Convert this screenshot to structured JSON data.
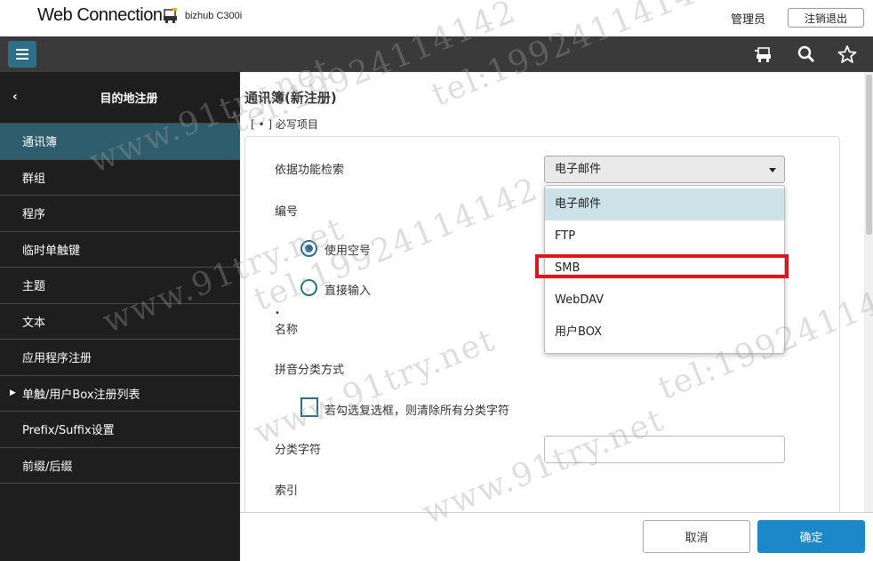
{
  "header": {
    "brand": "Web Connection",
    "device_name": "bizhub C300i",
    "user_label": "管理员",
    "logout_label": "注销退出"
  },
  "toolbar": {
    "icons": [
      "menu-icon",
      "printer-icon",
      "search-icon",
      "star-icon"
    ]
  },
  "sidebar": {
    "back_label": "‹",
    "title": "目的地注册",
    "items": [
      {
        "label": "通讯簿",
        "active": true
      },
      {
        "label": "群组"
      },
      {
        "label": "程序"
      },
      {
        "label": "临时单触键"
      },
      {
        "label": "主题"
      },
      {
        "label": "文本"
      },
      {
        "label": "应用程序注册"
      },
      {
        "label": "单触/用户Box注册列表",
        "expandable": true
      },
      {
        "label": "Prefix/Suffix设置"
      },
      {
        "label": "前缀/后缀"
      }
    ]
  },
  "main": {
    "page_title": "通讯簿(新注册)",
    "required_note": "[ • ] 必写项目",
    "form": {
      "search_by_function_label": "依据功能检索",
      "search_by_function_value": "电子邮件",
      "number_label": "编号",
      "radio_use_empty": "使用空号",
      "radio_direct_input": "直接输入",
      "required_mark": "•",
      "name_label": "名称",
      "pinyin_label": "拼音分类方式",
      "checkbox_label": "若勾选复选框，则清除所有分类字符",
      "category_char_label": "分类字符",
      "index_label": "索引"
    },
    "dropdown_options": [
      "电子邮件",
      "FTP",
      "SMB",
      "WebDAV",
      "用户BOX"
    ]
  },
  "footer": {
    "cancel_label": "取消",
    "ok_label": "确定"
  },
  "watermarks": [
    "www.91try.net",
    "tel:19924114142"
  ],
  "colors": {
    "accent": "#1c88c8",
    "sidebar_bg": "#1e1e1e",
    "sidebar_active": "#2e5d6e",
    "highlight": "#e0141e"
  }
}
